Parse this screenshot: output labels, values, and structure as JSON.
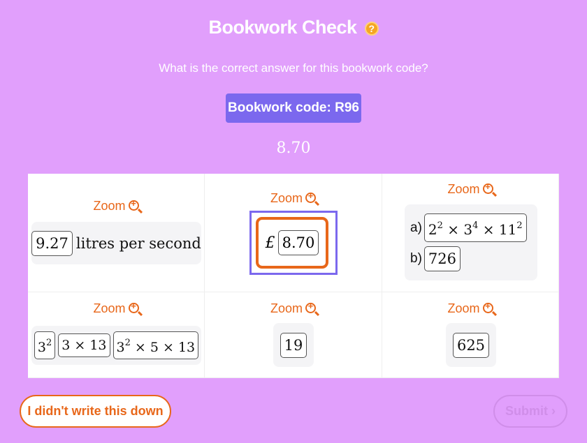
{
  "header": {
    "title": "Bookwork Check",
    "help_icon": "?",
    "subtitle": "What is the correct answer for this bookwork code?",
    "bookwork_code": "Bookwork code: R96",
    "written_answer": "8.70"
  },
  "zoom_label": "Zoom",
  "options": [
    {
      "value": "9.27",
      "unit": "litres per second"
    },
    {
      "prefix": "£",
      "value": "8.70",
      "selected": true
    },
    {
      "a_label": "a)",
      "a_parts": [
        "2",
        "2",
        "3",
        "4",
        "11",
        "2"
      ],
      "times": "×",
      "b_label": "b)",
      "b_value": "726"
    },
    {
      "boxes": [
        [
          "3",
          "2"
        ],
        [
          "3 × 13"
        ],
        [
          "3",
          "2",
          " × 5 × 13"
        ]
      ]
    },
    {
      "value": "19"
    },
    {
      "value": "625"
    }
  ],
  "footer": {
    "didnt_write": "I didn't write this down",
    "submit": "Submit",
    "submit_icon": "›"
  },
  "colors": {
    "background": "#e19ffc",
    "accent_orange": "#e8671a",
    "accent_purple": "#7b68ee"
  }
}
